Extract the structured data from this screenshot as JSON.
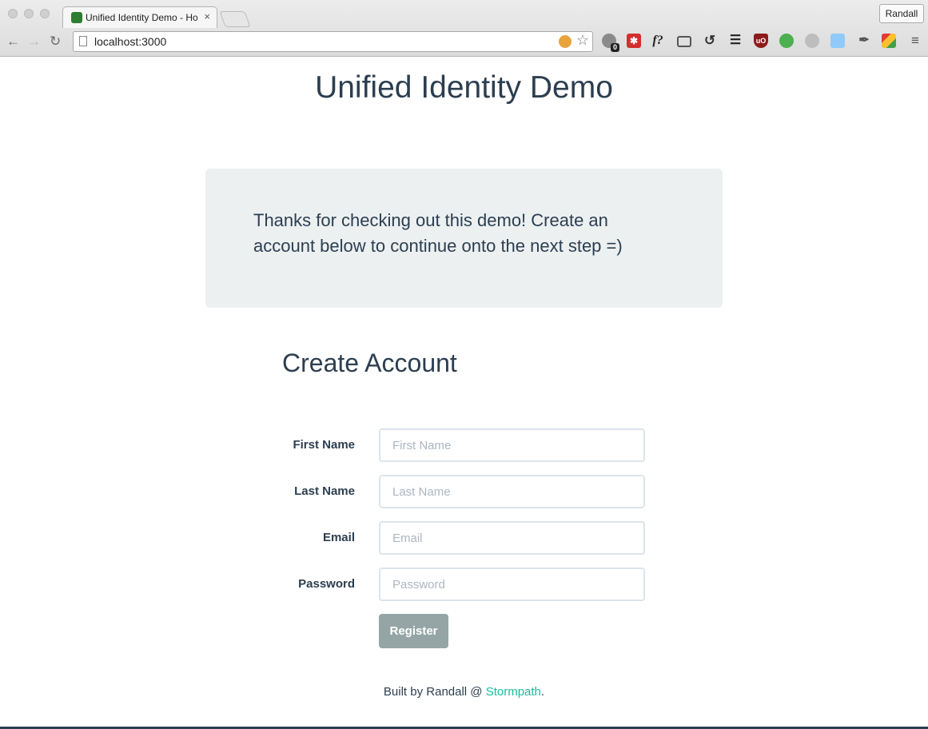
{
  "browser": {
    "tab_title": "Unified Identity Demo - Ho",
    "tab_close": "×",
    "profile_name": "Randall",
    "url": "localhost:3000",
    "extensions": [
      "ghostery",
      "lastpass",
      "whatfont",
      "cast",
      "sync",
      "buffer",
      "ublock",
      "pushbullet",
      "hypothesis",
      "screenshot",
      "eyedropper",
      "chrome-apps"
    ],
    "ext_badge": "0",
    "ext_text": {
      "whatfont": "f?",
      "ublock": "uO"
    }
  },
  "page": {
    "title": "Unified Identity Demo",
    "welcome_text": "Thanks for checking out this demo! Create an account below to continue onto the next step =)"
  },
  "form": {
    "heading": "Create Account",
    "fields": [
      {
        "label": "First Name",
        "placeholder": "First Name",
        "value": ""
      },
      {
        "label": "Last Name",
        "placeholder": "Last Name",
        "value": ""
      },
      {
        "label": "Email",
        "placeholder": "Email",
        "value": ""
      },
      {
        "label": "Password",
        "placeholder": "Password",
        "value": ""
      }
    ],
    "submit_label": "Register"
  },
  "footer": {
    "prefix": "Built by Randall @ ",
    "link_text": "Stormpath",
    "suffix": "."
  },
  "colors": {
    "primary": "#2c3e50",
    "link": "#18bc9c",
    "button": "#95a5a6",
    "panel": "#ecf0f1"
  }
}
